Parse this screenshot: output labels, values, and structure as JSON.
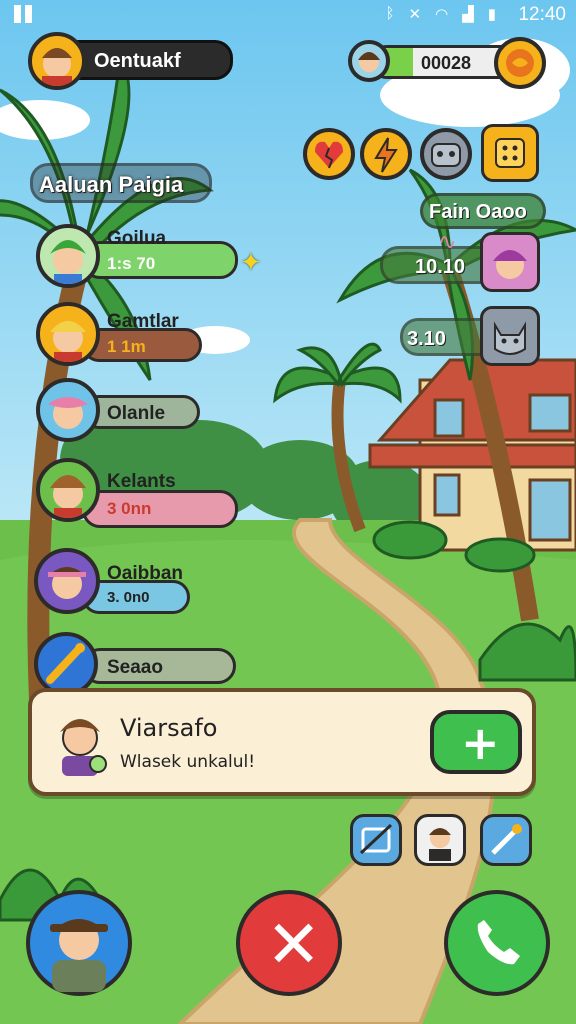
{
  "status": {
    "time": "12:40",
    "icons": [
      "bluetooth-icon",
      "mute-icon",
      "wifi-icon",
      "signal-icon",
      "battery-icon"
    ]
  },
  "player": {
    "name": "Oentuakf"
  },
  "currency": {
    "value": "00028"
  },
  "section_title": "Aaluan Paigia",
  "right_label": "Fain Oaoo",
  "friends": [
    {
      "name": "Goilua",
      "value": "1:s 70"
    },
    {
      "name": "Gamtlar",
      "value": "1 1m"
    },
    {
      "name": "Olanle",
      "value": ""
    },
    {
      "name": "Kelants",
      "value": "3 0nn"
    },
    {
      "name": "Oaibban",
      "value": "3. 0n0"
    },
    {
      "name": "Seaao",
      "value": ""
    }
  ],
  "right_entries": [
    {
      "value": "10.10"
    },
    {
      "value": "3.10"
    }
  ],
  "invite": {
    "title": "Viarsafo",
    "subtitle": "Wlasek unkalul!"
  },
  "colors": {
    "sky": "#8fd3f0",
    "grass": "#6cbf4a",
    "accent_green": "#3fbf4d",
    "accent_red": "#e23b3b",
    "accent_blue": "#1e88d8",
    "gold": "#f6b21b"
  }
}
